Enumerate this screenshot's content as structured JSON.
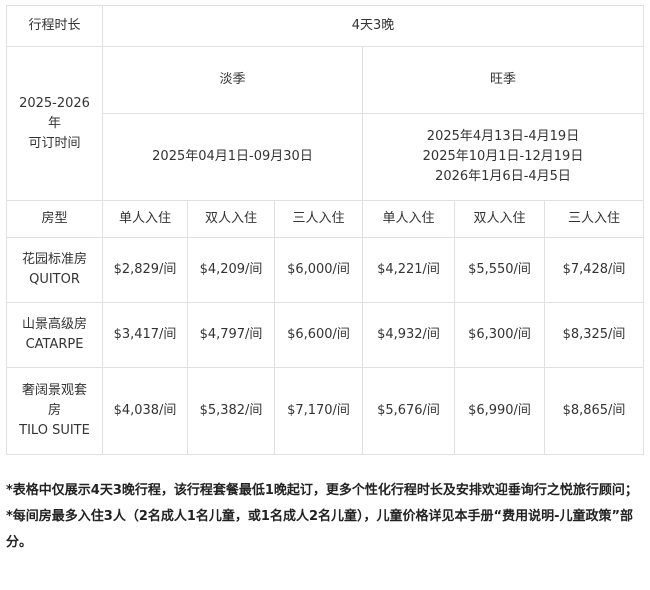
{
  "table": {
    "duration_label": "行程时长",
    "duration_value": "4天3晚",
    "booking_label_lines": [
      "2025-2026",
      "年",
      "可订时间"
    ],
    "low_season": {
      "label": "淡季",
      "dates": [
        "2025年04月1日-09月30日"
      ]
    },
    "high_season": {
      "label": "旺季",
      "dates": [
        "2025年4月13日-4月19日",
        "2025年10月1日-12月19日",
        "2026年1月6日-4月5日"
      ]
    },
    "room_type_label": "房型",
    "occupancy_headers": [
      "单人入住",
      "双人入住",
      "三人入住",
      "单人入住",
      "双人入住",
      "三人入住"
    ],
    "rooms": [
      {
        "name_lines": [
          "花园标准房",
          "QUITOR"
        ],
        "prices": [
          "$2,829/间",
          "$4,209/间",
          "$6,000/间",
          "$4,221/间",
          "$5,550/间",
          "$7,428/间"
        ]
      },
      {
        "name_lines": [
          "山景高级房",
          "CATARPE"
        ],
        "prices": [
          "$3,417/间",
          "$4,797/间",
          "$6,600/间",
          "$4,932/间",
          "$6,300/间",
          "$8,325/间"
        ]
      },
      {
        "name_lines": [
          "奢阔景观套",
          "房",
          "TILO SUITE"
        ],
        "prices": [
          "$4,038/间",
          "$5,382/间",
          "$7,170/间",
          "$5,676/间",
          "$6,990/间",
          "$8,865/间"
        ]
      }
    ]
  },
  "notes": [
    "*表格中仅展示4天3晚行程，该行程套餐最低1晚起订，更多个性化行程时长及安排欢迎垂询行之悦旅行顾问；",
    "*每间房最多入住3人（2名成人1名儿童，或1名成人2名儿童），儿童价格详见本手册“费用说明-儿童政策”部分。"
  ]
}
